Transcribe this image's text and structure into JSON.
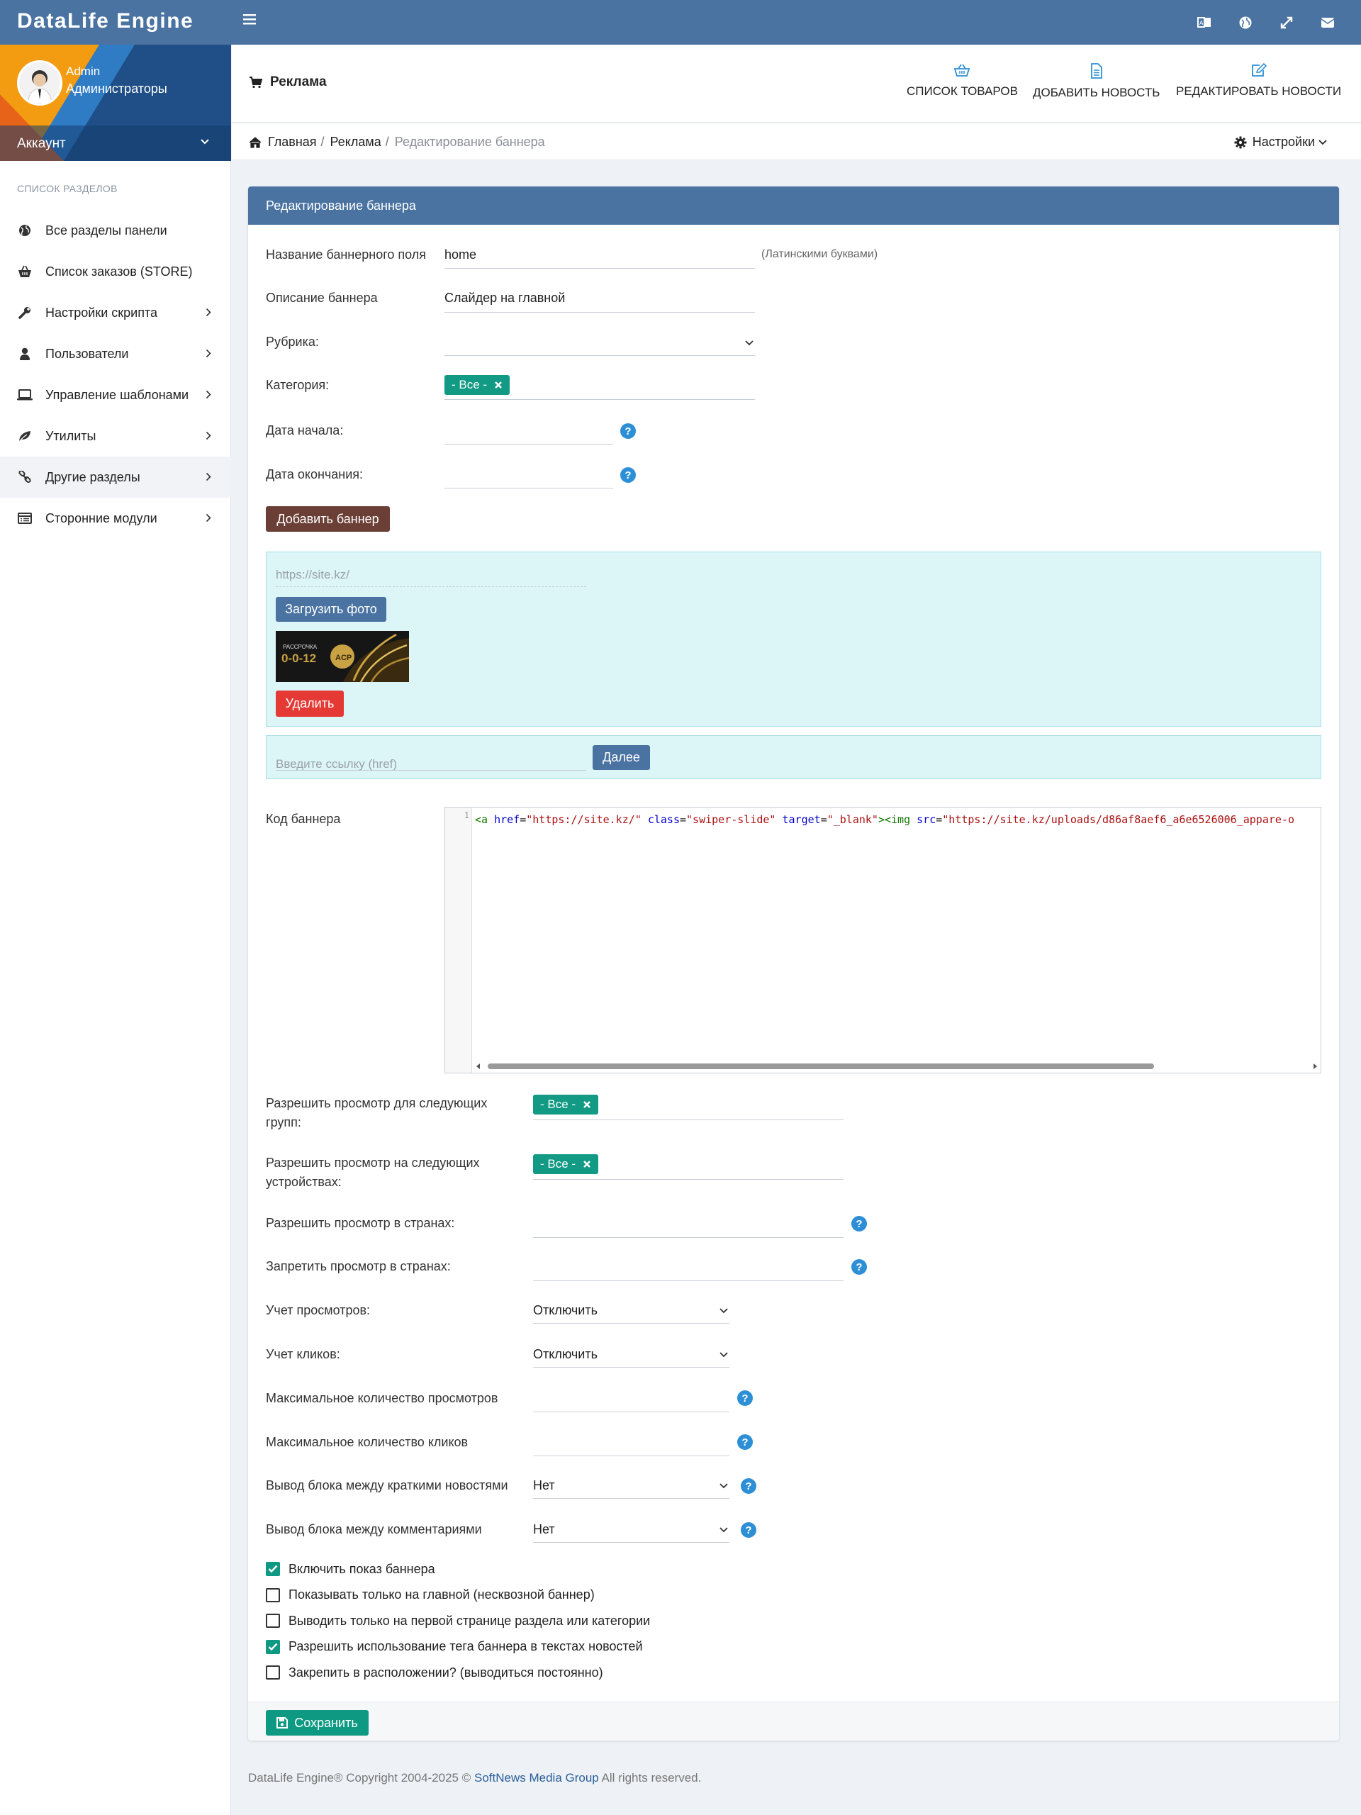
{
  "app": {
    "brand": "DataLife Engine"
  },
  "top_icons": [
    "translate-icon",
    "globe-icon",
    "fullscreen-icon",
    "envelope-icon"
  ],
  "profile": {
    "name": "Admin",
    "group": "Администраторы",
    "account_label": "Аккаунт"
  },
  "sidebar": {
    "section_title": "СПИСОК РАЗДЕЛОВ",
    "items": [
      {
        "label": "Все разделы панели",
        "icon": "globe-icon",
        "has_arrow": false
      },
      {
        "label": "Список заказов (STORE)",
        "icon": "basket-icon",
        "has_arrow": false
      },
      {
        "label": "Настройки скрипта",
        "icon": "wrench-icon",
        "has_arrow": true
      },
      {
        "label": "Пользователи",
        "icon": "user-icon",
        "has_arrow": true
      },
      {
        "label": "Управление шаблонами",
        "icon": "laptop-icon",
        "has_arrow": true
      },
      {
        "label": "Утилиты",
        "icon": "leaf-icon",
        "has_arrow": true
      },
      {
        "label": "Другие разделы",
        "icon": "link-icon",
        "has_arrow": true,
        "active": true
      },
      {
        "label": "Сторонние модули",
        "icon": "list-icon",
        "has_arrow": true
      }
    ]
  },
  "header": {
    "title": "Реклама",
    "quick_links": [
      {
        "label": "СПИСОК ТОВАРОВ",
        "icon": "basket-icon"
      },
      {
        "label": "ДОБАВИТЬ НОВОСТЬ",
        "icon": "file-icon"
      },
      {
        "label": "РЕДАКТИРОВАТЬ НОВОСТИ",
        "icon": "edit-icon"
      }
    ]
  },
  "breadcrumb": {
    "home": "Главная",
    "section": "Реклама",
    "current": "Редактирование баннера",
    "settings": "Настройки"
  },
  "form": {
    "panel_title": "Редактирование баннера",
    "banner_name": {
      "label": "Название баннерного поля",
      "value": "home",
      "hint": "(Латинскими буквами)"
    },
    "description": {
      "label": "Описание баннера",
      "value": "Слайдер на главной"
    },
    "rubric": {
      "label": "Рубрика:",
      "value": ""
    },
    "category": {
      "label": "Категория:",
      "tag": "- Все -"
    },
    "start_date": {
      "label": "Дата начала:",
      "value": ""
    },
    "end_date": {
      "label": "Дата окончания:",
      "value": ""
    },
    "add_banner_button": "Добавить баннер",
    "upload": {
      "url_placeholder": "https://site.kz/",
      "upload_button": "Загрузить фото",
      "image_text_top": "РАССРОЧКА",
      "image_text_main": "0-0-12",
      "image_badge": "ACP",
      "delete_button": "Удалить"
    },
    "link": {
      "placeholder": "Введите ссылку (href)",
      "next_button": "Далее"
    },
    "code": {
      "label": "Код баннера",
      "line_number": "1",
      "tokens": [
        {
          "t": "<a ",
          "c": "c-tag"
        },
        {
          "t": "href",
          "c": "c-attr"
        },
        {
          "t": "=",
          "c": "c-plain"
        },
        {
          "t": "\"https://site.kz/\"",
          "c": "c-str"
        },
        {
          "t": " class",
          "c": "c-attr"
        },
        {
          "t": "=",
          "c": "c-plain"
        },
        {
          "t": "\"swiper-slide\"",
          "c": "c-str"
        },
        {
          "t": " target",
          "c": "c-attr"
        },
        {
          "t": "=",
          "c": "c-plain"
        },
        {
          "t": "\"_blank\"",
          "c": "c-str"
        },
        {
          "t": "><img ",
          "c": "c-tag"
        },
        {
          "t": "src",
          "c": "c-attr"
        },
        {
          "t": "=",
          "c": "c-plain"
        },
        {
          "t": "\"https://site.kz/uploads/d86af8aef6_a6e6526006_appare-o",
          "c": "c-str"
        }
      ]
    },
    "groups": {
      "label": "Разрешить просмотр для следующих групп:",
      "tag": "- Все -"
    },
    "devices": {
      "label": "Разрешить просмотр на следующих устройствах:",
      "tag": "- Все -"
    },
    "allow_countries": {
      "label": "Разрешить просмотр в странах:",
      "value": ""
    },
    "deny_countries": {
      "label": "Запретить просмотр в странах:",
      "value": ""
    },
    "views_tracking": {
      "label": "Учет просмотров:",
      "value": "Отключить"
    },
    "clicks_tracking": {
      "label": "Учет кликов:",
      "value": "Отключить"
    },
    "max_views": {
      "label": "Максимальное количество просмотров",
      "value": ""
    },
    "max_clicks": {
      "label": "Максимальное количество кликов",
      "value": ""
    },
    "between_short": {
      "label": "Вывод блока между краткими новостями",
      "value": "Нет"
    },
    "between_comments": {
      "label": "Вывод блока между комментариями",
      "value": "Нет"
    },
    "checkboxes": [
      {
        "label": "Включить показ баннера",
        "checked": true
      },
      {
        "label": "Показывать только на главной (несквозной баннер)",
        "checked": false
      },
      {
        "label": "Выводить только на первой странице раздела или категории",
        "checked": false
      },
      {
        "label": "Разрешить использование тега баннера в текстах новостей",
        "checked": true
      },
      {
        "label": "Закрепить в расположении? (выводиться постоянно)",
        "checked": false
      }
    ],
    "save_button": "Сохранить"
  },
  "footer": {
    "prefix": "DataLife Engine® Copyright 2004-2025 ©",
    "link": "SoftNews Media Group",
    "suffix": "All rights reserved."
  },
  "colors": {
    "primary": "#4a73a2",
    "green": "#0e9a82",
    "brown": "#6b3f35",
    "red": "#e53935",
    "help": "#2d8fd5"
  }
}
